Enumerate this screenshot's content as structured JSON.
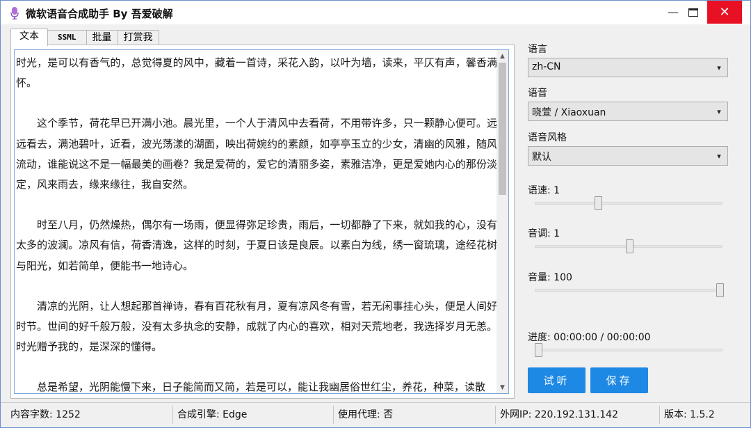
{
  "window": {
    "title": "微软语音合成助手 By 吾爱破解",
    "minimize_glyph": "—",
    "close_glyph": "✕"
  },
  "tabs": [
    {
      "label": "文本",
      "active": true
    },
    {
      "label": "SSML",
      "active": false
    },
    {
      "label": "批量",
      "active": false
    },
    {
      "label": "打赏我",
      "active": false
    }
  ],
  "editor": {
    "paragraphs": [
      "时光，是可以有香气的，总觉得夏的风中，藏着一首诗，采花入韵，以叶为墙，读来，平仄有声，馨香满怀。",
      "这个季节，荷花早已开满小池。晨光里，一个人于清风中去看荷，不用带许多，只一颗静心便可。远远看去，满池碧叶，近看，波光荡漾的湖面，映出荷婉约的素颜，如亭亭玉立的少女，清幽的风雅，随风流动，谁能说这不是一幅最美的画卷？我是爱荷的，爱它的清丽多姿，素雅洁净，更是爱她内心的那份淡定，风来雨去，缘来缘往，我自安然。",
      "时至八月，仍然燥热，偶尔有一场雨，便显得弥足珍贵，雨后，一切都静了下来，就如我的心，没有太多的波澜。凉风有信，荷香清逸，这样的时刻，于夏日该是良辰。以素白为线，绣一窗琉璃，途经花树与阳光，如若简单，便能书一地诗心。",
      "清凉的光阴，让人想起那首禅诗，春有百花秋有月，夏有凉风冬有雪，若无闲事挂心头，便是人间好时节。世间的好千般万般，没有太多执念的安静，成就了内心的喜欢，相对天荒地老，我选择岁月无恙。时光赠予我的，是深深的懂得。",
      "总是希望，光阴能慢下来，日子能简而又简，若是可以，能让我幽居俗世红尘，养花，种菜，读散"
    ],
    "scroll_up": "▲",
    "scroll_down": "▼"
  },
  "settings": {
    "language": {
      "label": "语言",
      "value": "zh-CN"
    },
    "voice": {
      "label": "语音",
      "value": "晓萱 / Xiaoxuan"
    },
    "style": {
      "label": "语音风格",
      "value": "默认"
    },
    "rate": {
      "label": "语速: 1",
      "level": 0.33
    },
    "pitch": {
      "label": "音调: 1",
      "level": 0.5
    },
    "volume": {
      "label": "音量: 100",
      "level": 1.0
    },
    "progress": {
      "label": "进度: 00:00:00 / 00:00:00",
      "level": 0.0
    },
    "chevron": "▾"
  },
  "buttons": {
    "listen": "试听",
    "save": "保存"
  },
  "statusbar": {
    "char_count": "内容字数: 1252",
    "engine": "合成引擎: Edge",
    "proxy": "使用代理: 否",
    "ip": "外网IP: 220.192.131.142",
    "version": "版本: 1.5.2"
  },
  "colors": {
    "accent": "#1e88e5",
    "close": "#e81123",
    "editor_border": "#7aa7d8"
  }
}
